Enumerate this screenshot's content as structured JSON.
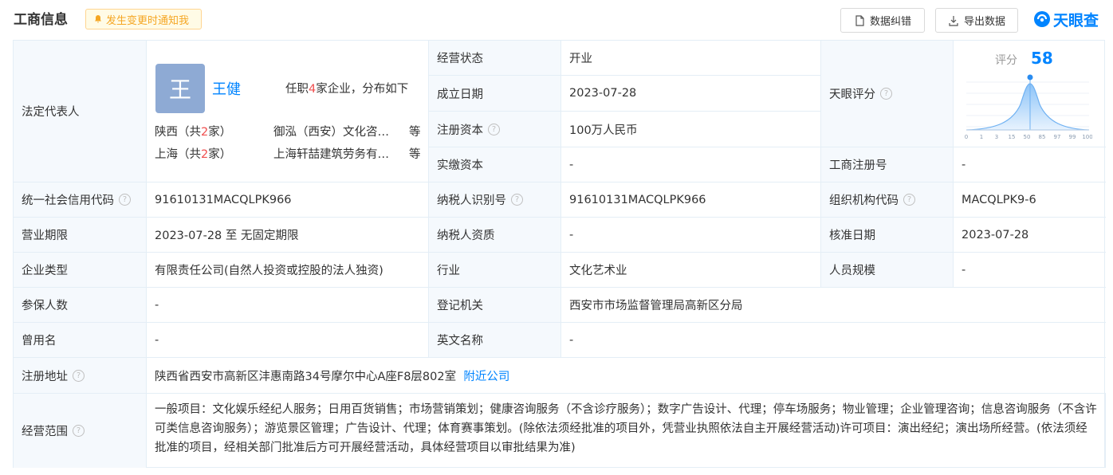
{
  "header": {
    "title": "工商信息",
    "notify_label": "发生变更时通知我",
    "error_button": "数据纠错",
    "export_button": "导出数据",
    "logo_text": "天眼查",
    "accent": "#0084ff"
  },
  "legal_rep": {
    "label": "法定代表人",
    "avatar_char": "王",
    "name": "王健",
    "info_prefix": "任职",
    "info_count": "4",
    "info_suffix": "家企业，分布如下",
    "regions": [
      {
        "prefix": "陕西（共",
        "count": "2",
        "suffix": "家）",
        "company": "御泓（西安）文化咨…",
        "etc": "等"
      },
      {
        "prefix": "上海（共",
        "count": "2",
        "suffix": "家）",
        "company": "上海轩喆建筑劳务有…",
        "etc": "等"
      }
    ]
  },
  "fields": {
    "status": {
      "label": "经营状态",
      "value": "开业"
    },
    "established": {
      "label": "成立日期",
      "value": "2023-07-28"
    },
    "reg_capital": {
      "label": "注册资本",
      "value": "100万人民币"
    },
    "paid_capital": {
      "label": "实缴资本",
      "value": "-"
    },
    "tianyan_score": {
      "label": "天眼评分"
    },
    "reg_no": {
      "label": "工商注册号",
      "value": "-"
    },
    "credit_code": {
      "label": "统一社会信用代码",
      "value": "91610131MACQLPK966"
    },
    "taxpayer_id": {
      "label": "纳税人识别号",
      "value": "91610131MACQLPK966"
    },
    "org_code": {
      "label": "组织机构代码",
      "value": "MACQLPK9-6"
    },
    "term": {
      "label": "营业期限",
      "value": "2023-07-28 至 无固定期限"
    },
    "taxpayer_qual": {
      "label": "纳税人资质",
      "value": "-"
    },
    "approval_date": {
      "label": "核准日期",
      "value": "2023-07-28"
    },
    "company_type": {
      "label": "企业类型",
      "value": "有限责任公司(自然人投资或控股的法人独资)"
    },
    "industry": {
      "label": "行业",
      "value": "文化艺术业"
    },
    "staff_size": {
      "label": "人员规模",
      "value": "-"
    },
    "insured": {
      "label": "参保人数",
      "value": "-"
    },
    "authority": {
      "label": "登记机关",
      "value": "西安市市场监督管理局高新区分局"
    },
    "former_name": {
      "label": "曾用名",
      "value": "-"
    },
    "english_name": {
      "label": "英文名称",
      "value": "-"
    },
    "address": {
      "label": "注册地址",
      "value": "陕西省西安市高新区沣惠南路34号摩尔中心A座F8层802室",
      "link": "附近公司"
    },
    "scope": {
      "label": "经营范围",
      "value": "一般项目：文化娱乐经纪人服务；日用百货销售；市场营销策划；健康咨询服务（不含诊疗服务）；数字广告设计、代理；停车场服务；物业管理；企业管理咨询；信息咨询服务（不含许可类信息咨询服务）；游览景区管理；广告设计、代理；体育赛事策划。(除依法须经批准的项目外，凭营业执照依法自主开展经营活动)许可项目：演出经纪；演出场所经营。(依法须经批准的项目，经相关部门批准后方可开展经营活动，具体经营项目以审批结果为准)"
    }
  },
  "score_widget": {
    "label": "评分",
    "score": "58",
    "ticks": [
      "0",
      "1",
      "3",
      "15",
      "50",
      "85",
      "97",
      "99",
      "100"
    ]
  }
}
